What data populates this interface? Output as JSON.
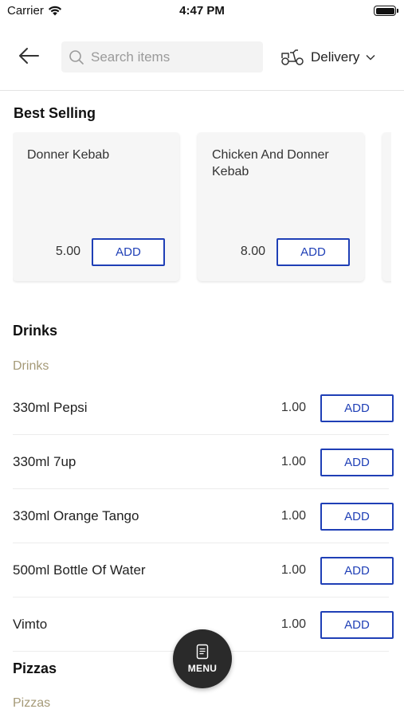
{
  "status_bar": {
    "carrier": "Carrier",
    "time": "4:47 PM"
  },
  "header": {
    "search_placeholder": "Search items",
    "delivery_label": "Delivery"
  },
  "best_selling": {
    "title": "Best Selling",
    "items": [
      {
        "name": "Donner Kebab",
        "price": "5.00",
        "add_label": "ADD"
      },
      {
        "name": "Chicken And Donner Kebab",
        "price": "8.00",
        "add_label": "ADD"
      }
    ]
  },
  "drinks": {
    "title": "Drinks",
    "subtitle": "Drinks",
    "items": [
      {
        "name": "330ml Pepsi",
        "price": "1.00",
        "add_label": "ADD"
      },
      {
        "name": "330ml 7up",
        "price": "1.00",
        "add_label": "ADD"
      },
      {
        "name": "330ml Orange Tango",
        "price": "1.00",
        "add_label": "ADD"
      },
      {
        "name": "500ml Bottle Of Water",
        "price": "1.00",
        "add_label": "ADD"
      },
      {
        "name": "Vimto",
        "price": "1.00",
        "add_label": "ADD"
      }
    ]
  },
  "pizzas": {
    "title": "Pizzas",
    "subtitle": "Pizzas"
  },
  "menu_button": {
    "label": "MENU"
  },
  "colors": {
    "accent": "#1f3fb6",
    "subtitle": "#a59a78",
    "fab": "#2a2a2a"
  }
}
